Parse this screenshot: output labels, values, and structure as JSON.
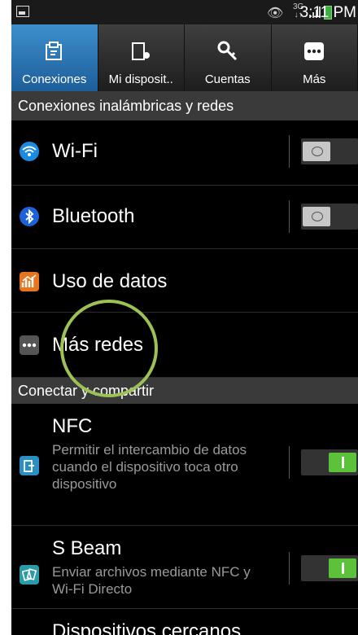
{
  "status": {
    "net_top": "3G",
    "net_bottom": "↓↑",
    "time": "3:11 PM"
  },
  "tabs": [
    {
      "label": "Conexiones",
      "icon": "connections-icon",
      "active": true
    },
    {
      "label": "Mi disposit..",
      "icon": "my-device-icon",
      "active": false
    },
    {
      "label": "Cuentas",
      "icon": "accounts-icon",
      "active": false
    },
    {
      "label": "Más",
      "icon": "more-icon",
      "active": false
    }
  ],
  "sections": {
    "wireless": "Conexiones inalámbricas y redes",
    "connect": "Conectar y compartir"
  },
  "rows": {
    "wifi": {
      "label": "Wi-Fi",
      "toggle": "off"
    },
    "bluetooth": {
      "label": "Bluetooth",
      "toggle": "off"
    },
    "data": {
      "label": "Uso de datos"
    },
    "more_networks": {
      "label": "Más redes"
    },
    "nfc": {
      "label": "NFC",
      "desc": "Permitir el intercambio de datos cuando el dispositivo toca otro dispositivo",
      "toggle": "on"
    },
    "sbeam": {
      "label": "S Beam",
      "desc": "Enviar archivos mediante NFC y Wi-Fi Directo",
      "toggle": "on"
    },
    "nearby": {
      "label": "Dispositivos cercanos"
    }
  },
  "colors": {
    "accent": "#2d7ab8",
    "toggle_on": "#5cc23a",
    "highlight_circle": "#9cc255"
  }
}
